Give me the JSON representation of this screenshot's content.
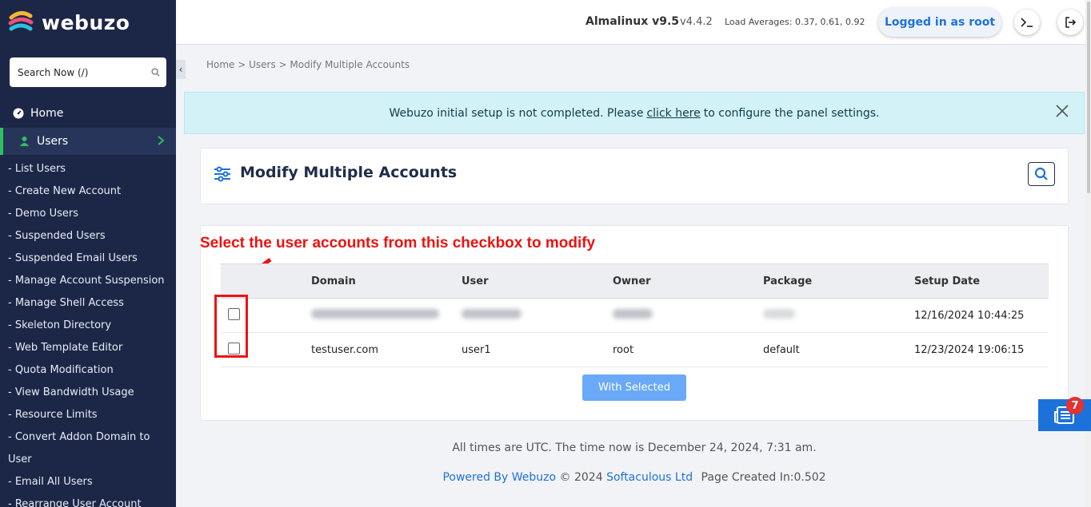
{
  "brand": {
    "name": "webuzo"
  },
  "sidebar": {
    "search_placeholder": "Search Now (/)",
    "home": "Home",
    "users": "Users",
    "submenu": [
      "- List Users",
      "- Create New Account",
      "- Demo Users",
      "- Suspended Users",
      "- Suspended Email Users",
      "- Manage Account Suspension",
      "- Manage Shell Access",
      "- Skeleton Directory",
      "- Web Template Editor",
      "- Quota Modification",
      "- View Bandwidth Usage",
      "- Resource Limits",
      "- Convert Addon Domain to User",
      "- Email All Users",
      "- Rearrange User Account"
    ]
  },
  "topbar": {
    "os": "Almalinux v9.5",
    "version": "v4.4.2",
    "load": "Load Averages: 0.37, 0.61, 0.92",
    "login": "Logged in as root"
  },
  "breadcrumb": "Home > Users > Modify Multiple Accounts",
  "alert": {
    "before": "Webuzo initial setup is not completed. Please",
    "link": "click here",
    "after": "to configure the panel settings."
  },
  "page": {
    "title": "Modify Multiple Accounts"
  },
  "annotation": "Select the user accounts from this checkbox to modify",
  "table": {
    "headers": [
      "Domain",
      "User",
      "Owner",
      "Package",
      "Setup Date"
    ],
    "rows": [
      {
        "domain": "",
        "user": "",
        "owner": "",
        "package": "",
        "date": "12/16/2024 10:44:25"
      },
      {
        "domain": "testuser.com",
        "user": "user1",
        "owner": "root",
        "package": "default",
        "date": "12/23/2024 19:06:15"
      }
    ]
  },
  "with_selected": "With Selected",
  "times": "All times are UTC. The time now is December 24, 2024, 7:31 am.",
  "footer": {
    "powered": "Powered By Webuzo",
    "copy": "© 2024",
    "company": "Softaculous Ltd",
    "created": "Page Created In:0.502"
  },
  "news_badge": "7",
  "colors": {
    "sidebar": "#1c2747",
    "accent": "#1d72d9",
    "annotation": "#ee1111"
  }
}
